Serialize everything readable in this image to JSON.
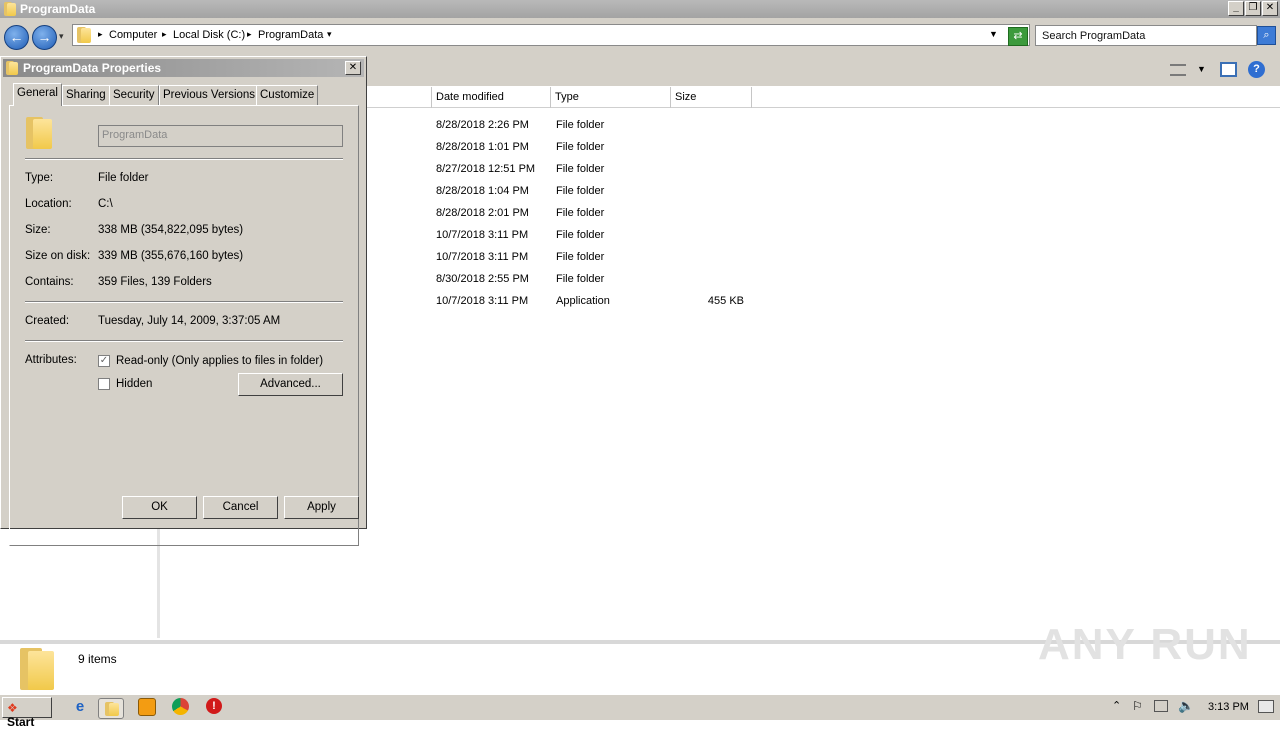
{
  "window": {
    "title": "ProgramData",
    "min": "_",
    "max": "❐",
    "close": "✕"
  },
  "address": {
    "breadcrumbs": [
      "Computer",
      "Local Disk (C:)",
      "ProgramData"
    ],
    "search_placeholder": "Search ProgramData"
  },
  "columns": [
    "Date modified",
    "Type",
    "Size"
  ],
  "files": [
    {
      "date": "8/28/2018 2:26 PM",
      "type": "File folder",
      "size": ""
    },
    {
      "date": "8/28/2018 1:01 PM",
      "type": "File folder",
      "size": ""
    },
    {
      "date": "8/27/2018 12:51 PM",
      "type": "File folder",
      "size": ""
    },
    {
      "date": "8/28/2018 1:04 PM",
      "type": "File folder",
      "size": ""
    },
    {
      "date": "8/28/2018 2:01 PM",
      "type": "File folder",
      "size": ""
    },
    {
      "date": "10/7/2018 3:11 PM",
      "type": "File folder",
      "size": ""
    },
    {
      "date": "10/7/2018 3:11 PM",
      "type": "File folder",
      "size": ""
    },
    {
      "date": "8/30/2018 2:55 PM",
      "type": "File folder",
      "size": ""
    },
    {
      "date": "10/7/2018 3:11 PM",
      "type": "Application",
      "size": "455 KB"
    }
  ],
  "status": {
    "items": "9 items"
  },
  "dialog": {
    "title": "ProgramData Properties",
    "tabs": [
      "General",
      "Sharing",
      "Security",
      "Previous Versions",
      "Customize"
    ],
    "name_value": "ProgramData",
    "type_label": "Type:",
    "type_value": "File folder",
    "location_label": "Location:",
    "location_value": "C:\\",
    "size_label": "Size:",
    "size_value": "338 MB (354,822,095 bytes)",
    "sizeondisk_label": "Size on disk:",
    "sizeondisk_value": "339 MB (355,676,160 bytes)",
    "contains_label": "Contains:",
    "contains_value": "359 Files, 139 Folders",
    "created_label": "Created:",
    "created_value": "Tuesday, July 14, 2009, 3:37:05 AM",
    "attributes_label": "Attributes:",
    "readonly_label": "Read-only (Only applies to files in folder)",
    "readonly_checked": true,
    "hidden_label": "Hidden",
    "hidden_checked": false,
    "advanced_label": "Advanced...",
    "ok_label": "OK",
    "cancel_label": "Cancel",
    "apply_label": "Apply"
  },
  "taskbar": {
    "start_label": "Start",
    "clock": "3:13 PM"
  },
  "watermark": "ANY RUN"
}
